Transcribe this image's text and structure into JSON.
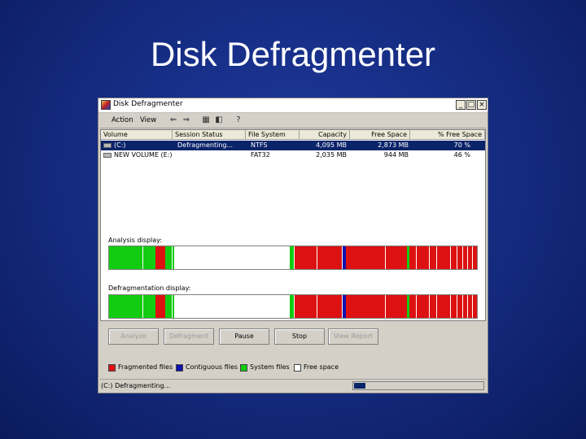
{
  "slide": {
    "title": "Disk Defragmenter"
  },
  "window": {
    "title": "Disk Defragmenter",
    "controls": {
      "minimize": "_",
      "maximize": "□",
      "close": "×"
    }
  },
  "menu": {
    "items": [
      "Action",
      "View"
    ]
  },
  "toolbar": {
    "icons": [
      "back-arrow-icon",
      "forward-arrow-icon",
      "properties-icon",
      "console-tree-icon",
      "help-icon"
    ]
  },
  "volumes": {
    "columns": [
      "Volume",
      "Session Status",
      "File System",
      "Capacity",
      "Free Space",
      "% Free Space"
    ],
    "rows": [
      {
        "volume": "(C:)",
        "status": "Defragmenting...",
        "fs": "NTFS",
        "capacity": "4,095 MB",
        "free": "2,873 MB",
        "pct": "70 %",
        "selected": true
      },
      {
        "volume": "NEW VOLUME (E:)",
        "status": "",
        "fs": "FAT32",
        "capacity": "2,035 MB",
        "free": "944 MB",
        "pct": "46 %",
        "selected": false
      }
    ]
  },
  "analysis": {
    "label": "Analysis display:"
  },
  "defrag": {
    "label": "Defragmentation display:"
  },
  "colors": {
    "fragmented": "#dd1111",
    "contiguous": "#1010b0",
    "system": "#11cc11",
    "free": "#ffffff"
  },
  "segments": [
    {
      "kind": "system",
      "start": 0.0,
      "width": 12.5
    },
    {
      "kind": "fragmented",
      "start": 12.5,
      "width": 2.8
    },
    {
      "kind": "system",
      "start": 15.3,
      "width": 2.4
    },
    {
      "kind": "free",
      "start": 17.7,
      "width": 31.5
    },
    {
      "kind": "system",
      "start": 49.2,
      "width": 1.0
    },
    {
      "kind": "fragmented",
      "start": 50.2,
      "width": 13.0
    },
    {
      "kind": "contiguous",
      "start": 63.2,
      "width": 1.2
    },
    {
      "kind": "fragmented",
      "start": 64.4,
      "width": 16.5
    },
    {
      "kind": "system",
      "start": 80.9,
      "width": 0.8
    },
    {
      "kind": "fragmented",
      "start": 81.7,
      "width": 18.3
    }
  ],
  "stripes": [
    9,
    17,
    50.2,
    56.5,
    63.2,
    75,
    83.5,
    87,
    89,
    92.8,
    94.5,
    96,
    97.3,
    98.6
  ],
  "buttons": [
    {
      "label": "Analyze",
      "enabled": false
    },
    {
      "label": "Defragment",
      "enabled": false
    },
    {
      "label": "Pause",
      "enabled": true
    },
    {
      "label": "Stop",
      "enabled": true
    },
    {
      "label": "View Report",
      "enabled": false
    }
  ],
  "legend": [
    {
      "label": "Fragmented files",
      "kind": "fragmented"
    },
    {
      "label": "Contiguous files",
      "kind": "contiguous"
    },
    {
      "label": "System files",
      "kind": "system"
    },
    {
      "label": "Free space",
      "kind": "free"
    }
  ],
  "status": {
    "text": "(C:) Defragmenting...",
    "progress": 0.09
  }
}
